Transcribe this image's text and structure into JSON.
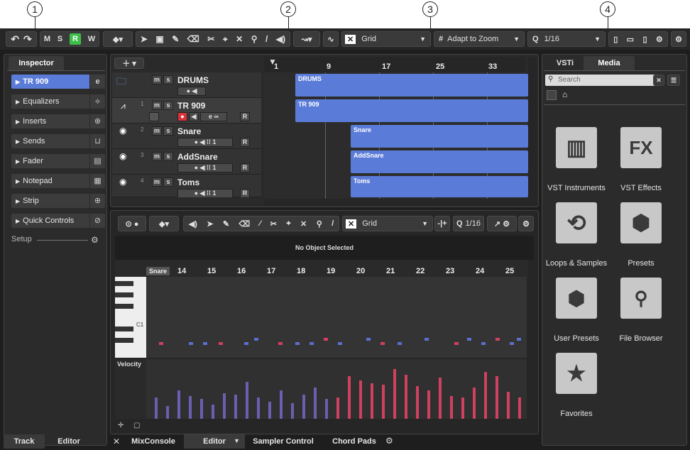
{
  "callouts": [
    "1",
    "2",
    "3",
    "4"
  ],
  "toolbar": {
    "m": "M",
    "s": "S",
    "r": "R",
    "w": "W",
    "grid": "Grid",
    "adapt": "Adapt to Zoom",
    "quant": "1/16",
    "undo": "↶",
    "redo": "↷"
  },
  "inspector": {
    "tab": "Inspector",
    "track_name": "TR 909",
    "items": [
      "Equalizers",
      "Inserts",
      "Sends",
      "Fader",
      "Notepad",
      "Strip",
      "Quick Controls"
    ],
    "setup": "Setup"
  },
  "tracks": [
    {
      "num": "",
      "name": "DRUMS",
      "clip": "DRUMS"
    },
    {
      "num": "1",
      "name": "TR 909",
      "clip": "TR 909"
    },
    {
      "num": "2",
      "name": "Snare",
      "clip": "Snare",
      "val": "1"
    },
    {
      "num": "3",
      "name": "AddSnare",
      "clip": "AddSnare",
      "val": "1"
    },
    {
      "num": "4",
      "name": "Toms",
      "clip": "Toms",
      "val": "1"
    }
  ],
  "ruler": [
    "1",
    "9",
    "17",
    "25",
    "33"
  ],
  "editor": {
    "grid": "Grid",
    "quant": "1/16",
    "status": "No Object Selected",
    "part": "Snare",
    "ruler": [
      "14",
      "15",
      "16",
      "17",
      "18",
      "19",
      "20",
      "21",
      "22",
      "23",
      "24",
      "25"
    ],
    "c1": "C1",
    "velocity": "Velocity"
  },
  "media": {
    "tabs": [
      "VSTi",
      "Media"
    ],
    "search": "Search",
    "items": [
      "VST Instruments",
      "VST Effects",
      "Loops & Samples",
      "Presets",
      "User Presets",
      "File Browser",
      "Favorites"
    ],
    "fx": "FX"
  },
  "bottom_tabs": {
    "left": [
      "Track",
      "Editor"
    ],
    "center": [
      "MixConsole",
      "Editor",
      "Sampler Control",
      "Chord Pads"
    ]
  },
  "colors": {
    "accent": "#5a7bd8",
    "record": "#d8323a",
    "active_r": "#3dbf4c",
    "note_blue": "#5b6fd0",
    "note_red": "#d04060"
  }
}
